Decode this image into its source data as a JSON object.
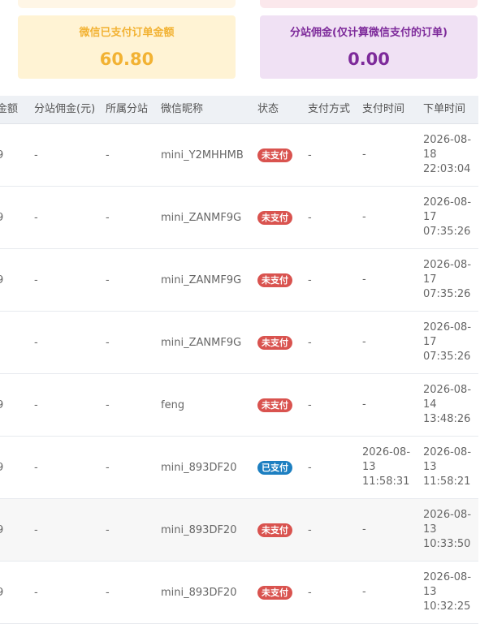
{
  "cards": {
    "wechat_paid": {
      "title": "微信已支付订单金额",
      "value": "60.80"
    },
    "branch_commission": {
      "title": "分站佣金(仅计算微信支付的订单)",
      "value": "0.00"
    }
  },
  "table": {
    "headers": [
      "金额",
      "分站佣金(元)",
      "所属分站",
      "微信昵称",
      "状态",
      "支付方式",
      "支付时间",
      "下单时间"
    ],
    "rows": [
      {
        "amount": "9",
        "commission": "-",
        "branch": "-",
        "nickname": "mini_Y2MHHMB",
        "status": "未支付",
        "status_type": "unpaid",
        "pay_method": "-",
        "pay_time": [
          "-"
        ],
        "order_time": [
          "2026-08-",
          "18",
          "22:03:04"
        ]
      },
      {
        "amount": "9",
        "commission": "-",
        "branch": "-",
        "nickname": "mini_ZANMF9G",
        "status": "未支付",
        "status_type": "unpaid",
        "pay_method": "-",
        "pay_time": [
          "-"
        ],
        "order_time": [
          "2026-08-",
          "17",
          "07:35:26"
        ]
      },
      {
        "amount": "9",
        "commission": "-",
        "branch": "-",
        "nickname": "mini_ZANMF9G",
        "status": "未支付",
        "status_type": "unpaid",
        "pay_method": "-",
        "pay_time": [
          "-"
        ],
        "order_time": [
          "2026-08-",
          "17",
          "07:35:26"
        ]
      },
      {
        "amount": "",
        "commission": "-",
        "branch": "-",
        "nickname": "mini_ZANMF9G",
        "status": "未支付",
        "status_type": "unpaid",
        "pay_method": "-",
        "pay_time": [
          "-"
        ],
        "order_time": [
          "2026-08-",
          "17",
          "07:35:26"
        ]
      },
      {
        "amount": "9",
        "commission": "-",
        "branch": "-",
        "nickname": "feng",
        "status": "未支付",
        "status_type": "unpaid",
        "pay_method": "-",
        "pay_time": [
          "-"
        ],
        "order_time": [
          "2026-08-",
          "14",
          "13:48:26"
        ]
      },
      {
        "amount": "9",
        "commission": "-",
        "branch": "-",
        "nickname": "mini_893DF20",
        "status": "已支付",
        "status_type": "paid",
        "pay_method": "-",
        "pay_time": [
          "2026-08-",
          "13",
          "11:58:31"
        ],
        "order_time": [
          "2026-08-",
          "13",
          "11:58:21"
        ]
      },
      {
        "amount": "9",
        "commission": "-",
        "branch": "-",
        "nickname": "mini_893DF20",
        "status": "未支付",
        "status_type": "unpaid",
        "pay_method": "-",
        "pay_time": [
          "-"
        ],
        "order_time": [
          "2026-08-",
          "13",
          "10:33:50"
        ]
      },
      {
        "amount": "9",
        "commission": "-",
        "branch": "-",
        "nickname": "mini_893DF20",
        "status": "未支付",
        "status_type": "unpaid",
        "pay_method": "-",
        "pay_time": [
          "-"
        ],
        "order_time": [
          "2026-08-",
          "13",
          "10:32:25"
        ]
      }
    ]
  }
}
